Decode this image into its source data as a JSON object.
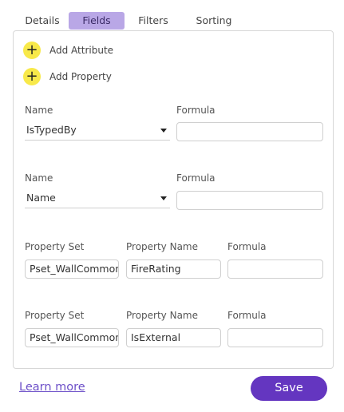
{
  "tabs": [
    {
      "label": "Details"
    },
    {
      "label": "Fields"
    },
    {
      "label": "Filters"
    },
    {
      "label": "Sorting"
    }
  ],
  "active_tab": "Fields",
  "add_attribute_label": "Add Attribute",
  "add_property_label": "Add Property",
  "field_rows": [
    {
      "name_label": "Name",
      "formula_label": "Formula",
      "name_value": "IsTypedBy",
      "formula_value": ""
    },
    {
      "name_label": "Name",
      "formula_label": "Formula",
      "name_value": "Name",
      "formula_value": ""
    }
  ],
  "property_rows": [
    {
      "set_label": "Property Set",
      "name_label": "Property Name",
      "formula_label": "Formula",
      "set_value": "Pset_WallCommon",
      "name_value": "FireRating",
      "formula_value": ""
    },
    {
      "set_label": "Property Set",
      "name_label": "Property Name",
      "formula_label": "Formula",
      "set_value": "Pset_WallCommon",
      "name_value": "IsExternal",
      "formula_value": ""
    }
  ],
  "learn_more_label": "Learn more",
  "save_label": "Save",
  "colors": {
    "accent": "#6436c0",
    "tab_active": "#b9a7e6",
    "plus": "#f8e94a",
    "link": "#6c4fc8"
  }
}
